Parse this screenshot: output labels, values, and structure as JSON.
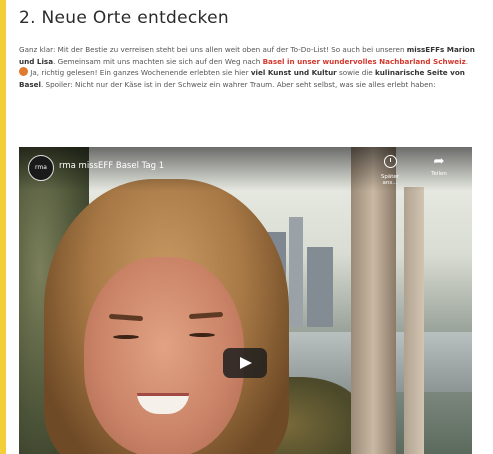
{
  "section": {
    "heading": "2. Neue Orte entdecken"
  },
  "intro": {
    "t1": "Ganz klar: Mit der Bestie zu verreisen steht bei uns allen weit oben auf der To-Do-List! So auch bei unseren ",
    "b1": "missEFFs Marion und Lisa",
    "t2": ". Gemeinsam mit uns machten sie sich auf den Weg nach ",
    "link1": "Basel in unser wundervolles Nachbarland Schweiz",
    "t3": ". ",
    "t4": " Ja, richtig gelesen! Ein ganzes Wochenende erlebten sie hier ",
    "b2": "viel Kunst und Kultur",
    "t5": " sowie die ",
    "b3": "kulinarische Seite von Basel",
    "t6": ". Spoiler: Nicht nur der Käse ist in der Schweiz ein wahrer Traum. Aber seht selbst, was sie alles erlebt haben:"
  },
  "video": {
    "channel_badge": "rma",
    "title": "rma missEFF Basel Tag 1",
    "watch_later_label": "Später ans...",
    "share_label": "Teilen"
  },
  "colors": {
    "accent_bar": "#f2cf3a",
    "link": "#d2382d"
  }
}
